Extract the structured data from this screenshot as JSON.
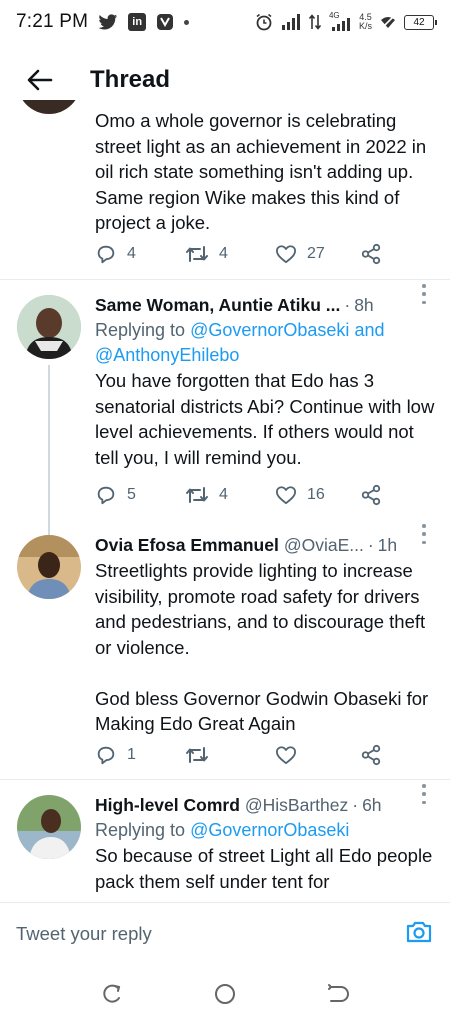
{
  "status_bar": {
    "time": "7:21 PM",
    "left_icons": [
      "twitter-bird-icon",
      "linkedin-icon",
      "viber-icon",
      "notification-dot"
    ],
    "right_icons": [
      "alarm-icon",
      "signal-icon",
      "data-arrows-icon",
      "4g-signal-icon",
      "speed-icon",
      "wifi-off-icon",
      "battery-icon"
    ],
    "network_label": "4G",
    "speed_value": "4.5",
    "speed_unit": "K/s",
    "battery_level": "42"
  },
  "header": {
    "title": "Thread",
    "back_icon": "arrow-left-icon"
  },
  "colors": {
    "accent": "#1d9bf0",
    "text_primary": "#0f1419",
    "text_secondary": "#536471",
    "divider": "#e6ecf0"
  },
  "tweets": [
    {
      "text": "Omo a whole governor is celebrating street light as an achievement in 2022 in oil rich state something isn't adding up. Same region Wike makes this kind of project a joke.",
      "replies": "4",
      "retweets": "4",
      "likes": "27"
    },
    {
      "name": "Same Woman, Auntie Atiku ...",
      "sep": "·",
      "time": "8h",
      "replying_prefix": "Replying to",
      "replying_link_1": "@GovernorObaseki",
      "replying_and": "and",
      "replying_link_2": "@AnthonyEhilebo",
      "text": "You have forgotten that Edo has 3 senatorial districts Abi? Continue with low level achievements. If others would not tell you, I will remind you.",
      "replies": "5",
      "retweets": "4",
      "likes": "16"
    },
    {
      "name": "Ovia Efosa Emmanuel",
      "handle": "@OviaE...",
      "sep": "·",
      "time": "1h",
      "text": "Streetlights provide lighting to increase visibility, promote road safety for drivers and pedestrians, and to discourage theft or violence.\n\nGod bless Governor Godwin Obaseki for Making Edo Great Again",
      "replies": "1",
      "retweets": "",
      "likes": ""
    },
    {
      "name": "High-level Comrd",
      "handle": "@HisBarthez",
      "sep": "·",
      "time": "6h",
      "replying_prefix": "Replying to",
      "replying_link_1": "@GovernorObaseki",
      "text": "So because of street Light all Edo people pack them self under tent for"
    }
  ],
  "reply_bar": {
    "placeholder": "Tweet your reply",
    "camera_icon": "camera-icon"
  },
  "nav_bar": {
    "icons": [
      "recent-apps-icon",
      "home-circle-icon",
      "back-nav-icon"
    ]
  }
}
